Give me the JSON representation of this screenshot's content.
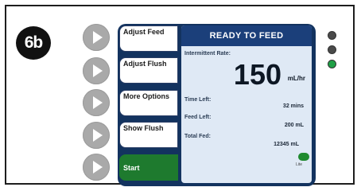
{
  "step_label": "6b",
  "softkeys": [
    {
      "label": "Adjust Feed"
    },
    {
      "label": "Adjust Flush"
    },
    {
      "label": "More Options"
    },
    {
      "label": "Show Flush"
    },
    {
      "label": "Start"
    }
  ],
  "status_bar": {
    "title": "READY TO FEED"
  },
  "rate": {
    "label": "Intermittent Rate:",
    "value": "150",
    "unit": "mL/hr"
  },
  "fields": [
    {
      "label": "Time Left:",
      "value": "32 mins"
    },
    {
      "label": "Feed Left:",
      "value": "200 mL"
    },
    {
      "label": "Total Fed:",
      "value": "12345 mL"
    }
  ],
  "toggle_label": "Lite",
  "indicators": [
    {
      "name": "indicator-1",
      "color": "#4a4a4a"
    },
    {
      "name": "indicator-2",
      "color": "#4a4a4a"
    },
    {
      "name": "indicator-3",
      "color": "#1fa046"
    }
  ]
}
